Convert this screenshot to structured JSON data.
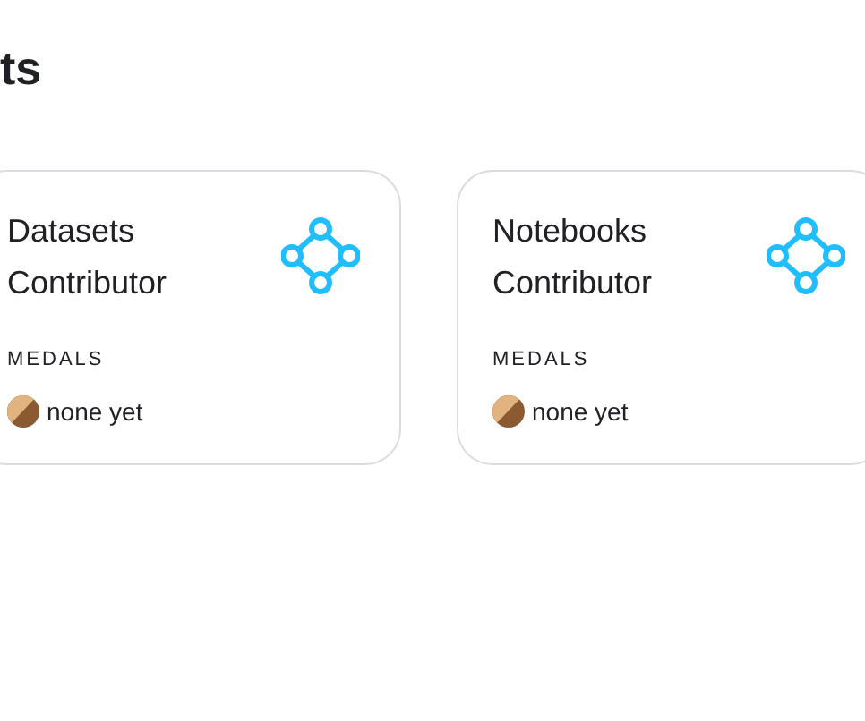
{
  "heading": "ts",
  "cards": [
    {
      "title": "Datasets Contributor",
      "medals_label": "MEDALS",
      "medals": "none yet"
    },
    {
      "title": "Notebooks Contributor",
      "medals_label": "MEDALS",
      "medals": "none yet"
    }
  ]
}
